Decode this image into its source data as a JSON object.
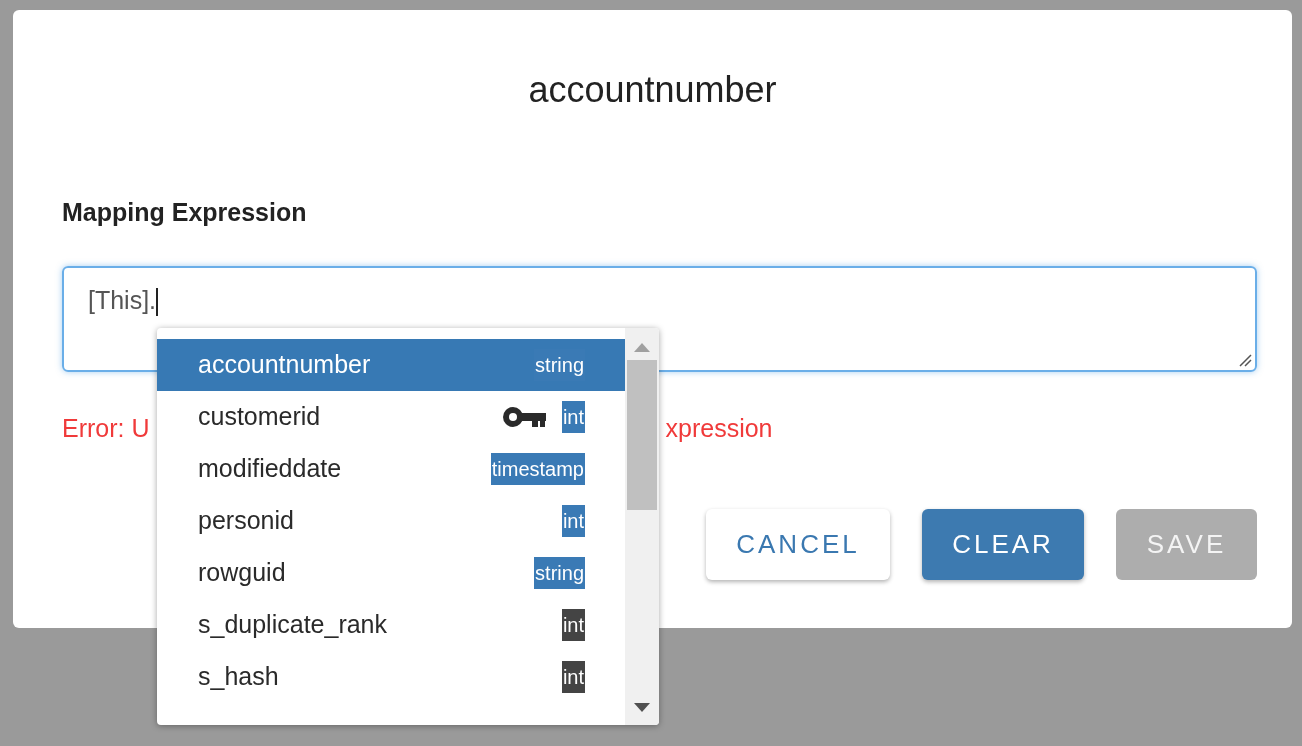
{
  "dialog": {
    "title": "accountnumber",
    "field_label": "Mapping Expression",
    "expression": {
      "value": "[This]."
    },
    "error_parts": [
      "Error: U",
      "xpression"
    ],
    "buttons": [
      {
        "label": "CANCEL",
        "kind": "outlined",
        "disabled": false
      },
      {
        "label": "CLEAR",
        "kind": "filled",
        "disabled": false
      },
      {
        "label": "SAVE",
        "kind": "filled",
        "disabled": true
      }
    ]
  },
  "autocomplete": {
    "items": [
      {
        "name": "accountnumber",
        "type": "string",
        "color": "#3a7ab5",
        "key": false,
        "selected": true
      },
      {
        "name": "customerid",
        "type": "int",
        "color": "#3a7ab5",
        "key": true,
        "selected": false
      },
      {
        "name": "modifieddate",
        "type": "timestamp",
        "color": "#3a7ab5",
        "key": false,
        "selected": false
      },
      {
        "name": "personid",
        "type": "int",
        "color": "#3a7ab5",
        "key": false,
        "selected": false
      },
      {
        "name": "rowguid",
        "type": "string",
        "color": "#3a7ab5",
        "key": false,
        "selected": false
      },
      {
        "name": "s_duplicate_rank",
        "type": "int",
        "color": "#444444",
        "key": false,
        "selected": false
      },
      {
        "name": "s_hash",
        "type": "int",
        "color": "#444444",
        "key": false,
        "selected": false
      }
    ]
  }
}
